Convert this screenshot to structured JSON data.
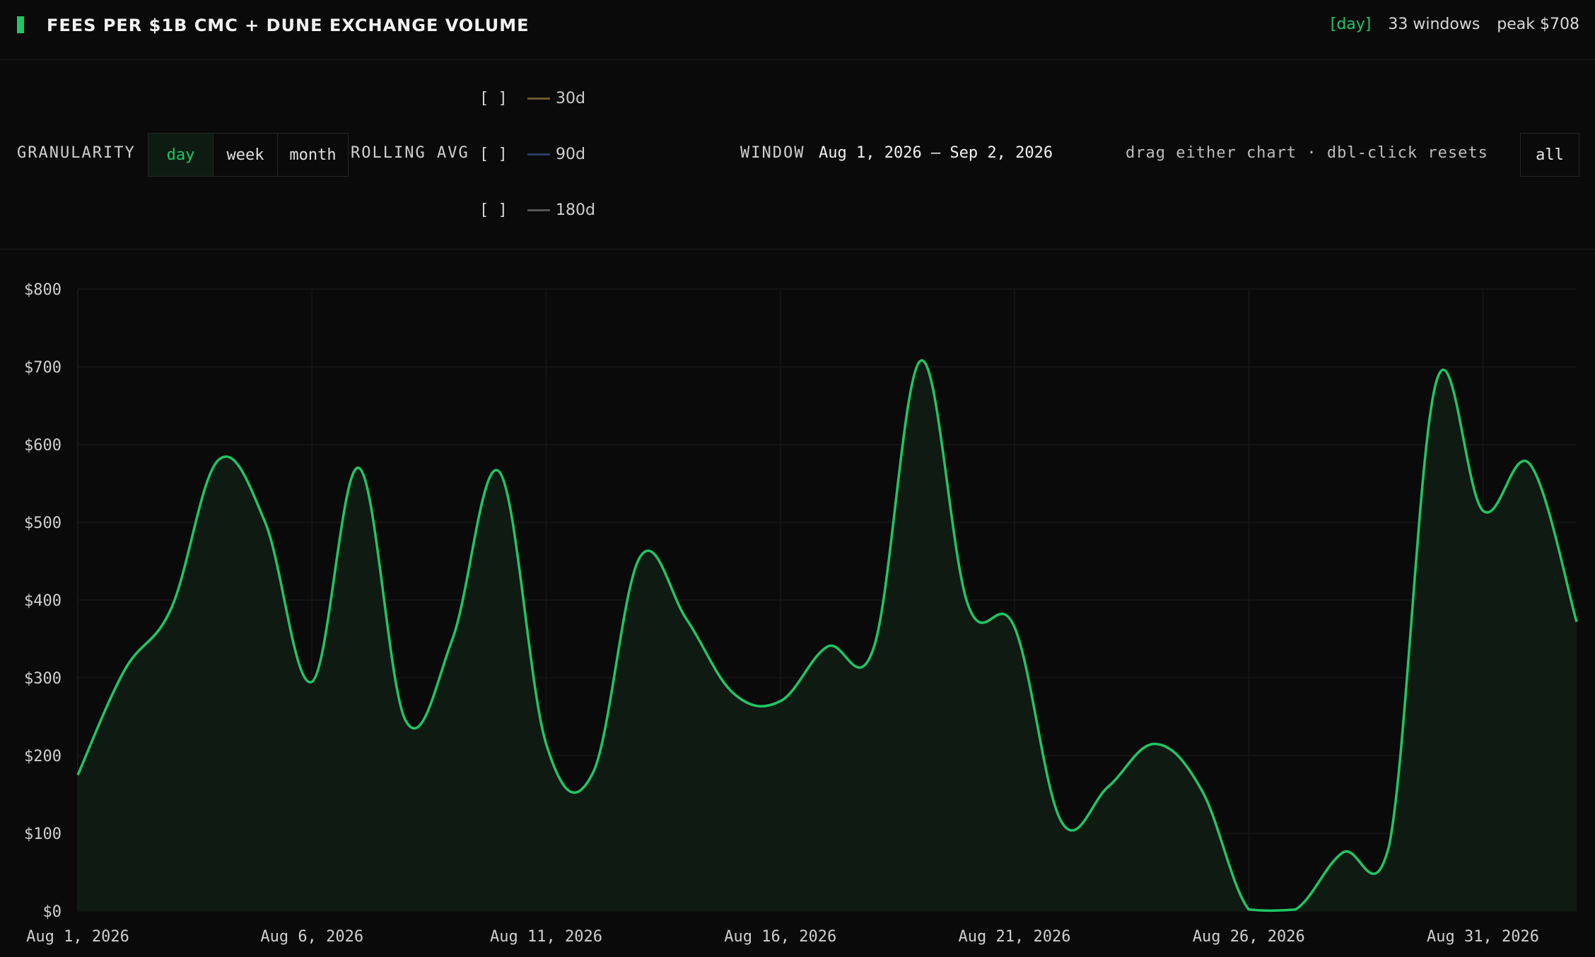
{
  "header": {
    "title": "FEES PER $1B CMC + DUNE EXCHANGE VOLUME",
    "granularity_tag": "[day]",
    "windows": "33 windows",
    "peak": "peak $708"
  },
  "controls": {
    "granularity_label": "GRANULARITY",
    "granularity_options": [
      "day",
      "week",
      "month"
    ],
    "granularity_selected": "day",
    "rolling_label": "ROLLING AVG",
    "rolling_checkbox": "[  ]",
    "rolling": [
      {
        "label": "30d",
        "color": "#6b5a2a"
      },
      {
        "label": "90d",
        "color": "#2a3c5a"
      },
      {
        "label": "180d",
        "color": "#555555"
      }
    ],
    "window_label": "WINDOW",
    "window_range": "Aug 1, 2026 — Sep 2, 2026",
    "hint": "drag either chart · dbl-click resets",
    "reset_label": "all"
  },
  "chart_data": {
    "type": "area",
    "line_color": "#1ec765",
    "fill_color": "#0f1a13",
    "x": [
      "Aug 1, 2026",
      "Aug 2, 2026",
      "Aug 3, 2026",
      "Aug 4, 2026",
      "Aug 5, 2026",
      "Aug 6, 2026",
      "Aug 7, 2026",
      "Aug 8, 2026",
      "Aug 9, 2026",
      "Aug 10, 2026",
      "Aug 11, 2026",
      "Aug 12, 2026",
      "Aug 13, 2026",
      "Aug 14, 2026",
      "Aug 15, 2026",
      "Aug 16, 2026",
      "Aug 17, 2026",
      "Aug 18, 2026",
      "Aug 19, 2026",
      "Aug 20, 2026",
      "Aug 21, 2026",
      "Aug 22, 2026",
      "Aug 23, 2026",
      "Aug 24, 2026",
      "Aug 25, 2026",
      "Aug 26, 2026",
      "Aug 27, 2026",
      "Aug 28, 2026",
      "Aug 29, 2026",
      "Aug 30, 2026",
      "Aug 31, 2026",
      "Sep 1, 2026",
      "Sep 2, 2026"
    ],
    "values": [
      175,
      310,
      390,
      580,
      500,
      295,
      570,
      245,
      350,
      565,
      215,
      178,
      455,
      375,
      280,
      270,
      340,
      340,
      708,
      395,
      365,
      115,
      160,
      215,
      155,
      2,
      2,
      75,
      85,
      680,
      515,
      575,
      372
    ],
    "yticks": [
      "$0",
      "$100",
      "$200",
      "$300",
      "$400",
      "$500",
      "$600",
      "$700",
      "$800"
    ],
    "xticks": [
      "Aug 1, 2026",
      "Aug 6, 2026",
      "Aug 11, 2026",
      "Aug 16, 2026",
      "Aug 21, 2026",
      "Aug 26, 2026",
      "Aug 31, 2026"
    ],
    "ylim": [
      0,
      800
    ],
    "grid": true
  }
}
